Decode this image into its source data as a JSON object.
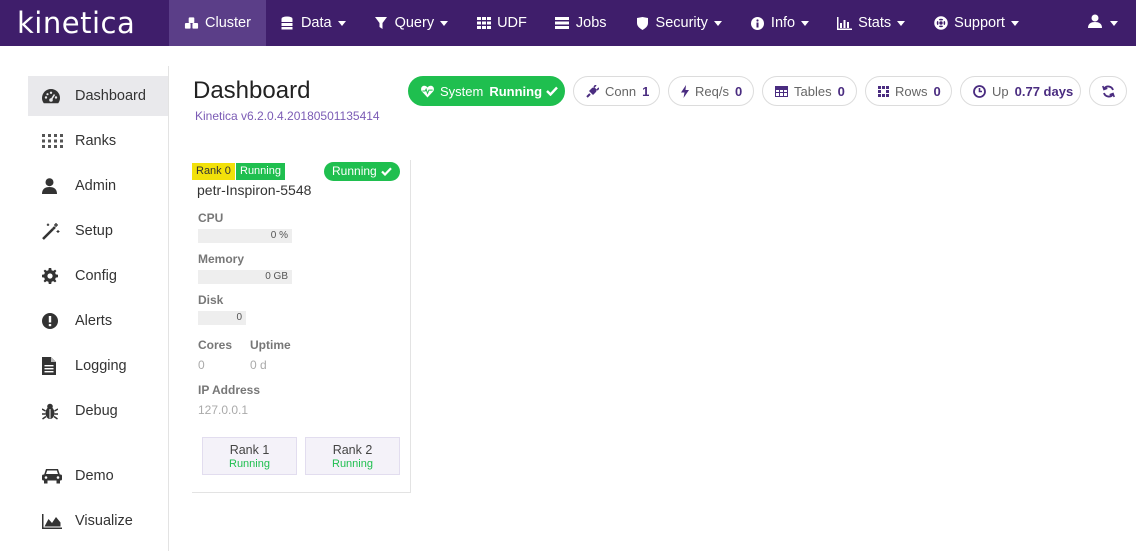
{
  "brand": {
    "logo_text": "kinetica"
  },
  "nav": {
    "items": [
      {
        "label": "Cluster",
        "icon": "cubes-icon",
        "caret": false,
        "active": true
      },
      {
        "label": "Data",
        "icon": "database-icon",
        "caret": true,
        "active": false
      },
      {
        "label": "Query",
        "icon": "filter-icon",
        "caret": true,
        "active": false
      },
      {
        "label": "UDF",
        "icon": "grid-icon",
        "caret": false,
        "active": false
      },
      {
        "label": "Jobs",
        "icon": "list-icon",
        "caret": false,
        "active": false
      },
      {
        "label": "Security",
        "icon": "shield-icon",
        "caret": true,
        "active": false
      },
      {
        "label": "Info",
        "icon": "info-circle-icon",
        "caret": true,
        "active": false
      },
      {
        "label": "Stats",
        "icon": "bar-chart-icon",
        "caret": true,
        "active": false
      },
      {
        "label": "Support",
        "icon": "life-ring-icon",
        "caret": true,
        "active": false
      }
    ],
    "user_icon": "user-icon"
  },
  "sidebar": {
    "items": [
      {
        "label": "Dashboard",
        "icon": "dashboard-icon",
        "active": true
      },
      {
        "label": "Ranks",
        "icon": "ranks-grid-icon",
        "active": false
      },
      {
        "label": "Admin",
        "icon": "user-icon",
        "active": false
      },
      {
        "label": "Setup",
        "icon": "magic-wand-icon",
        "active": false
      },
      {
        "label": "Config",
        "icon": "gear-icon",
        "active": false
      },
      {
        "label": "Alerts",
        "icon": "exclamation-circle-icon",
        "active": false
      },
      {
        "label": "Logging",
        "icon": "file-text-icon",
        "active": false
      },
      {
        "label": "Debug",
        "icon": "bug-icon",
        "active": false
      }
    ],
    "extra_items": [
      {
        "label": "Demo",
        "icon": "car-icon"
      },
      {
        "label": "Visualize",
        "icon": "area-chart-icon"
      }
    ]
  },
  "header": {
    "title": "Dashboard",
    "version": "Kinetica v6.2.0.4.20180501135414"
  },
  "status_pills": {
    "system": {
      "label": "System",
      "value": "Running"
    },
    "conn": {
      "label": "Conn",
      "value": "1"
    },
    "reqs": {
      "label": "Req/s",
      "value": "0"
    },
    "tables": {
      "label": "Tables",
      "value": "0"
    },
    "rows": {
      "label": "Rows",
      "value": "0"
    },
    "uptime": {
      "label": "Up",
      "value": "0.77 days"
    }
  },
  "rank_card": {
    "rank_tag": "Rank 0",
    "status_tag": "Running",
    "status_badge": "Running",
    "hostname": "petr-Inspiron-5548",
    "cpu": {
      "label": "CPU",
      "value": "0 %",
      "fraction": 0
    },
    "memory": {
      "label": "Memory",
      "value": "0 GB",
      "fraction": 0
    },
    "disk": {
      "label": "Disk",
      "value": "0",
      "fraction": 0
    },
    "cores": {
      "label": "Cores",
      "value": "0"
    },
    "uptime": {
      "label": "Uptime",
      "value": "0 d"
    },
    "ip": {
      "label": "IP Address",
      "value": "127.0.0.1"
    },
    "sub_ranks": [
      {
        "name": "Rank 1",
        "status": "Running"
      },
      {
        "name": "Rank 2",
        "status": "Running"
      }
    ]
  },
  "colors": {
    "navbar": "#3f1e6b",
    "navbar_active": "#5b3e88",
    "accent_purple": "#4a2c80",
    "running_green": "#1fbf4f",
    "rank_yellow": "#f2e10a"
  }
}
